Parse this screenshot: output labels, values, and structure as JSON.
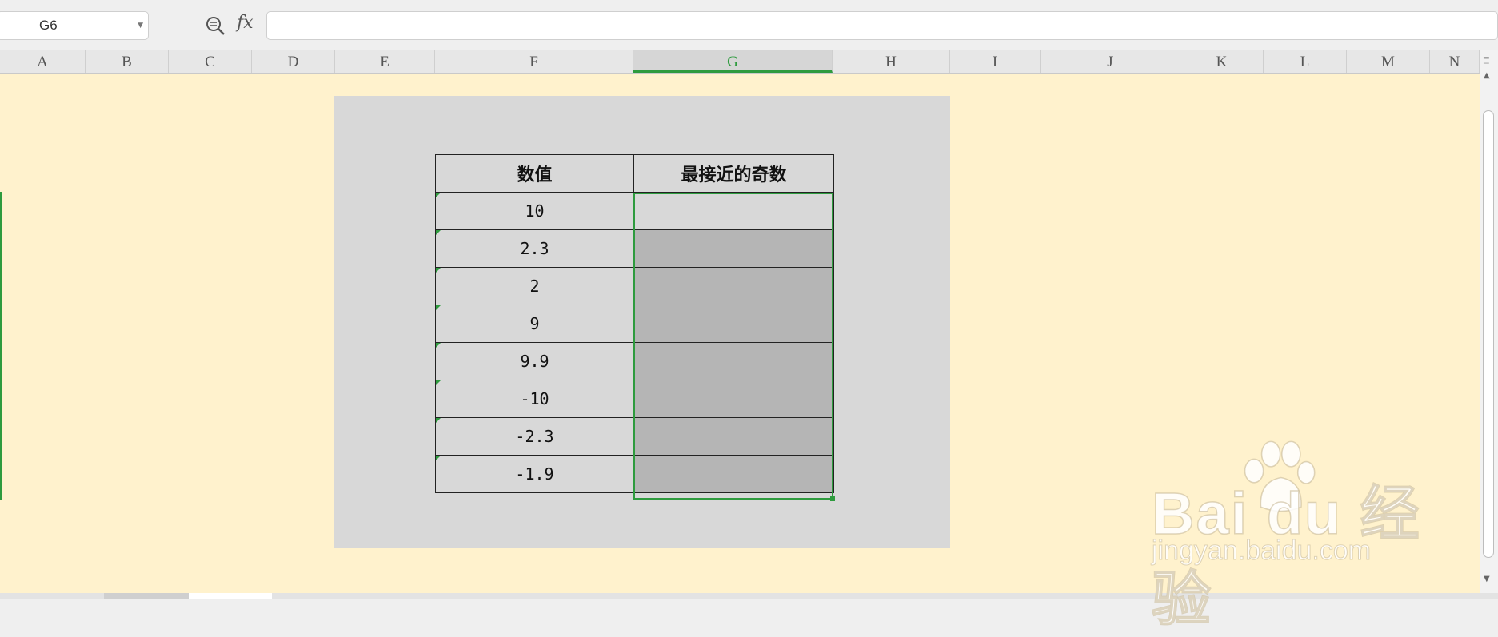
{
  "formula_bar": {
    "name_box": "G6",
    "fx_label": "fx",
    "formula": ""
  },
  "columns": [
    "A",
    "B",
    "C",
    "D",
    "E",
    "F",
    "G",
    "H",
    "I",
    "J",
    "K",
    "L",
    "M",
    "N"
  ],
  "selected_column": "G",
  "table": {
    "headers": [
      "数值",
      "最接近的奇数"
    ],
    "rows": [
      {
        "value": "10",
        "result": ""
      },
      {
        "value": "2.3",
        "result": ""
      },
      {
        "value": "2",
        "result": ""
      },
      {
        "value": "9",
        "result": ""
      },
      {
        "value": "9.9",
        "result": ""
      },
      {
        "value": "-10",
        "result": ""
      },
      {
        "value": "-2.3",
        "result": ""
      },
      {
        "value": "-1.9",
        "result": ""
      }
    ]
  },
  "watermark": {
    "brand": "Bai du 经验",
    "url": "jingyan.baidu.com"
  },
  "colors": {
    "selection": "#2e9b3e",
    "sheet_background": "#fff2cd",
    "panel": "#d8d8d8"
  },
  "icons": {
    "zoom": "zoom-formula-icon",
    "fx": "function-icon"
  }
}
